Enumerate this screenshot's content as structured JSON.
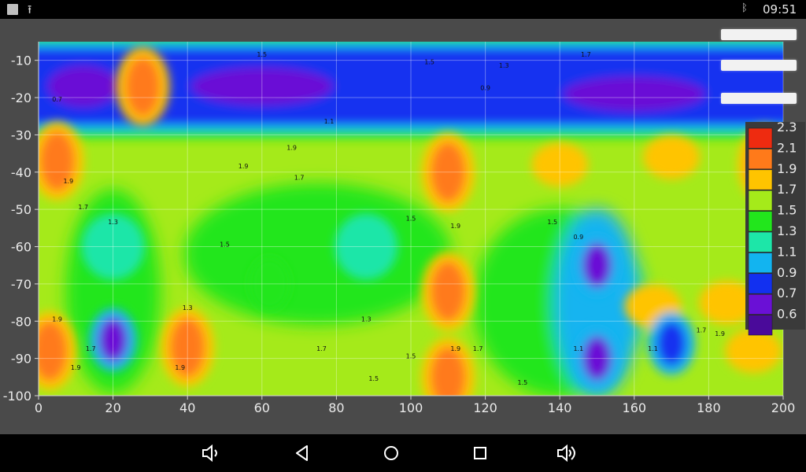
{
  "status_bar": {
    "time": "09:51",
    "icons": [
      "notification-square-icon",
      "upload-icon",
      "bluetooth-icon"
    ]
  },
  "nav_bar": {
    "buttons": [
      "volume-down-icon",
      "back-icon",
      "home-icon",
      "recents-icon",
      "volume-up-icon"
    ]
  },
  "side_buttons": [
    "",
    "",
    ""
  ],
  "chart_data": {
    "type": "heatmap",
    "title": "",
    "xlabel": "",
    "ylabel": "",
    "xlim": [
      0,
      200
    ],
    "ylim": [
      -100,
      -5
    ],
    "x_ticks": [
      "0",
      "20",
      "40",
      "60",
      "80",
      "100",
      "120",
      "140",
      "160",
      "180",
      "200"
    ],
    "y_ticks": [
      "-10",
      "-20",
      "-30",
      "-40",
      "-50",
      "-60",
      "-70",
      "-80",
      "-90",
      "-100"
    ],
    "grid": true,
    "colorbar": {
      "levels": [
        "2.3",
        "2.1",
        "1.9",
        "1.7",
        "1.5",
        "1.3",
        "1.1",
        "0.9",
        "0.7",
        "0.6"
      ],
      "colors": [
        "#ee2b10",
        "#ff7a1a",
        "#ffc400",
        "#a5ea1a",
        "#22e61c",
        "#1de6a8",
        "#12b4f0",
        "#1230f0",
        "#6a10d6",
        "#4a0a9a"
      ]
    },
    "features": [
      {
        "x": [
          0,
          200
        ],
        "y": [
          -8,
          -26
        ],
        "value": 0.7,
        "shape": "band"
      },
      {
        "x": 28,
        "y": -17,
        "value": 2.1
      },
      {
        "x": 110,
        "y": -40,
        "value": 2.1
      },
      {
        "x": 5,
        "y": -37,
        "value": 2.1
      },
      {
        "x": 140,
        "y": -38,
        "value": 1.9
      },
      {
        "x": 170,
        "y": -36,
        "value": 1.9
      },
      {
        "x": 195,
        "y": -38,
        "value": 2.1
      },
      {
        "x": 20,
        "y": -60,
        "value": 1.3
      },
      {
        "x": 20,
        "y": -85,
        "value": 0.7
      },
      {
        "x": 40,
        "y": -87,
        "value": 2.1
      },
      {
        "x": 3,
        "y": -88,
        "value": 2.1
      },
      {
        "x": 88,
        "y": -60,
        "value": 1.3
      },
      {
        "x": 110,
        "y": -72,
        "value": 2.1
      },
      {
        "x": 110,
        "y": -95,
        "value": 2.1
      },
      {
        "x": 150,
        "y": -65,
        "value": 0.7
      },
      {
        "x": 150,
        "y": -90,
        "value": 0.7
      },
      {
        "x": 165,
        "y": -76,
        "value": 1.9
      },
      {
        "x": 170,
        "y": -86,
        "value": 0.9
      },
      {
        "x": 185,
        "y": -75,
        "value": 1.9
      },
      {
        "x": 192,
        "y": -88,
        "value": 1.9
      },
      {
        "x": 62,
        "y": -70,
        "value": 1.5
      }
    ],
    "contour_labels": [
      {
        "x": 60,
        "y": -9,
        "text": "1.5"
      },
      {
        "x": 147,
        "y": -9,
        "text": "1.7"
      },
      {
        "x": 105,
        "y": -11,
        "text": "1.5"
      },
      {
        "x": 125,
        "y": -12,
        "text": "1.3"
      },
      {
        "x": 5,
        "y": -21,
        "text": "0.7"
      },
      {
        "x": 120,
        "y": -18,
        "text": "0.9"
      },
      {
        "x": 78,
        "y": -27,
        "text": "1.1"
      },
      {
        "x": 185,
        "y": -20,
        "text": "0.7"
      },
      {
        "x": 8,
        "y": -43,
        "text": "1.9"
      },
      {
        "x": 55,
        "y": -39,
        "text": "1.9"
      },
      {
        "x": 68,
        "y": -34,
        "text": "1.9"
      },
      {
        "x": 70,
        "y": -42,
        "text": "1.7"
      },
      {
        "x": 12,
        "y": -50,
        "text": "1.7"
      },
      {
        "x": 20,
        "y": -54,
        "text": "1.3"
      },
      {
        "x": 50,
        "y": -60,
        "text": "1.5"
      },
      {
        "x": 100,
        "y": -53,
        "text": "1.5"
      },
      {
        "x": 112,
        "y": -55,
        "text": "1.9"
      },
      {
        "x": 138,
        "y": -54,
        "text": "1.5"
      },
      {
        "x": 145,
        "y": -58,
        "text": "0.9"
      },
      {
        "x": 5,
        "y": -80,
        "text": "1.9"
      },
      {
        "x": 40,
        "y": -77,
        "text": "1.3"
      },
      {
        "x": 88,
        "y": -80,
        "text": "1.3"
      },
      {
        "x": 100,
        "y": -90,
        "text": "1.5"
      },
      {
        "x": 112,
        "y": -88,
        "text": "1.9"
      },
      {
        "x": 118,
        "y": -88,
        "text": "1.7"
      },
      {
        "x": 145,
        "y": -88,
        "text": "1.1"
      },
      {
        "x": 165,
        "y": -88,
        "text": "1.1"
      },
      {
        "x": 178,
        "y": -83,
        "text": "1.7"
      },
      {
        "x": 183,
        "y": -84,
        "text": "1.9"
      },
      {
        "x": 10,
        "y": -93,
        "text": "1.9"
      },
      {
        "x": 14,
        "y": -88,
        "text": "1.7"
      },
      {
        "x": 38,
        "y": -93,
        "text": "1.9"
      },
      {
        "x": 76,
        "y": -88,
        "text": "1.7"
      },
      {
        "x": 90,
        "y": -96,
        "text": "1.5"
      },
      {
        "x": 130,
        "y": -97,
        "text": "1.5"
      }
    ]
  }
}
